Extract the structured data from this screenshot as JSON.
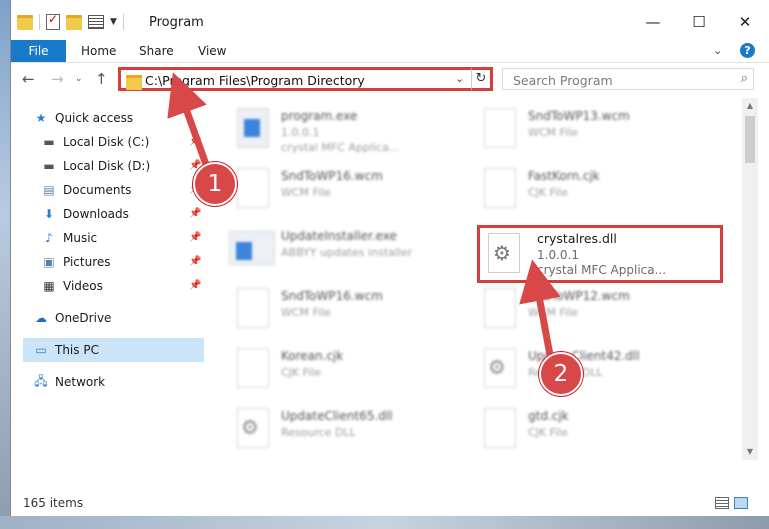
{
  "window": {
    "title": "Program",
    "controls": {
      "minimize": "—",
      "maximize": "☐",
      "close": "✕"
    }
  },
  "ribbon": {
    "tabs": [
      "File",
      "Home",
      "Share",
      "View"
    ],
    "help": "?"
  },
  "address_bar": {
    "path": "C:\\Program Files\\Program Directory"
  },
  "search": {
    "placeholder": "Search Program"
  },
  "sidebar": {
    "quick_access": "Quick access",
    "items": [
      {
        "label": "Local Disk (C:)",
        "icon": "drive-icon"
      },
      {
        "label": "Local Disk (D:)",
        "icon": "drive-icon"
      },
      {
        "label": "Documents",
        "icon": "documents-icon"
      },
      {
        "label": "Downloads",
        "icon": "downloads-icon"
      },
      {
        "label": "Music",
        "icon": "music-icon"
      },
      {
        "label": "Pictures",
        "icon": "pictures-icon"
      },
      {
        "label": "Videos",
        "icon": "videos-icon"
      }
    ],
    "onedrive": "OneDrive",
    "this_pc": "This PC",
    "network": "Network"
  },
  "files": [
    {
      "name": "program.exe",
      "line2": "1.0.0.1",
      "line3": "crystal MFC Applica..."
    },
    {
      "name": "SndToWP13.wcm",
      "line2": "WCM File",
      "line3": ""
    },
    {
      "name": "SndToWP16.wcm",
      "line2": "WCM File",
      "line3": ""
    },
    {
      "name": "FastKorn.cjk",
      "line2": "CJK File",
      "line3": ""
    },
    {
      "name": "UpdateInstaller.exe",
      "line2": "ABBYY updates installer",
      "line3": ""
    },
    {
      "name": "SndToWP16.wcm",
      "line2": "WCM File",
      "line3": ""
    },
    {
      "name": "SndToWP12.wcm",
      "line2": "WCM File",
      "line3": ""
    },
    {
      "name": "Korean.cjk",
      "line2": "CJK File",
      "line3": ""
    },
    {
      "name": "UpdateClient42.dll",
      "line2": "Resource DLL",
      "line3": ""
    },
    {
      "name": "UpdateClient65.dll",
      "line2": "Resource DLL",
      "line3": ""
    },
    {
      "name": "gtd.cjk",
      "line2": "CJK File",
      "line3": ""
    }
  ],
  "highlighted_file": {
    "name": "crystalres.dll",
    "version": "1.0.0.1",
    "description": "crystal MFC Applica..."
  },
  "status": {
    "item_count": "165 items"
  },
  "callouts": [
    "1",
    "2"
  ],
  "colors": {
    "accent": "#1979ca",
    "highlight_red": "#d43e3e",
    "selection": "#cce4f7"
  }
}
